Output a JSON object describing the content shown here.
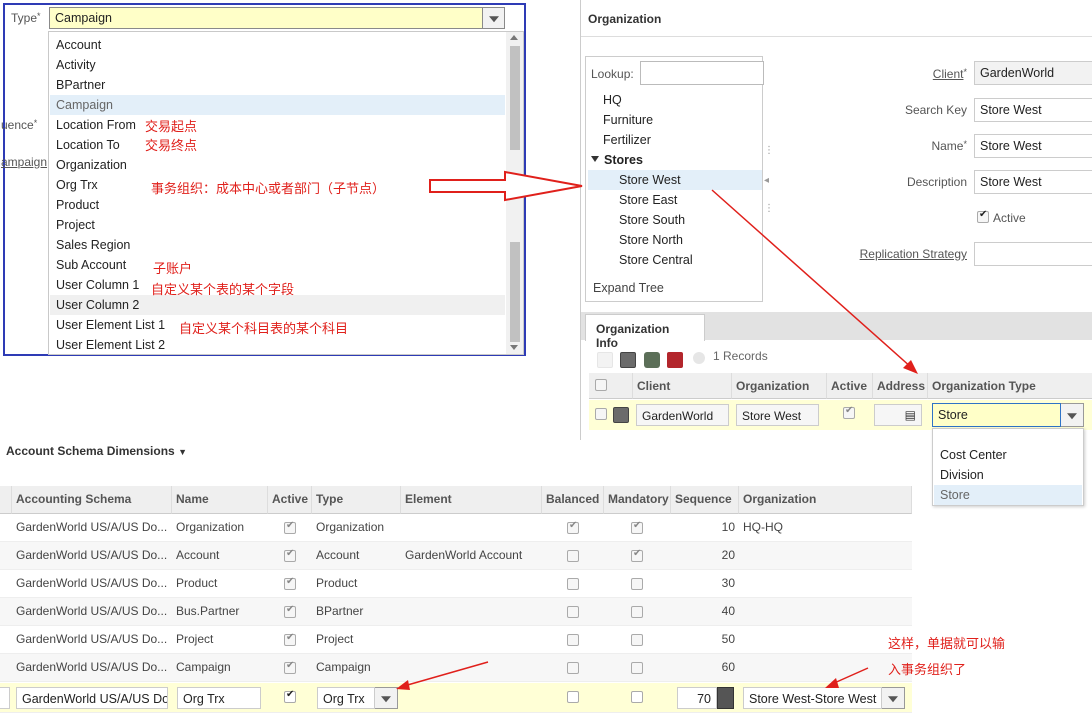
{
  "type_field": {
    "label": "Type",
    "required_mark": "*",
    "value": "Campaign",
    "options": [
      "Account",
      "Activity",
      "BPartner",
      "Campaign",
      "Location From",
      "Location To",
      "Organization",
      "Org Trx",
      "Product",
      "Project",
      "Sales Region",
      "Sub Account",
      "User Column 1",
      "User Column 2",
      "User Element List 1",
      "User Element List 2"
    ],
    "selected_option": "Campaign",
    "side_labels": {
      "sequence": "uence",
      "campaign": "ampaign"
    }
  },
  "annotations": {
    "location_from": "交易起点",
    "location_to": "交易终点",
    "org_trx": "事务组织：成本中心或者部门（子节点）",
    "sub_account": "子账户",
    "user_column": "自定义某个表的某个字段",
    "user_element_list": "自定义某个科目表的某个科目",
    "conclusion_line1": "这样，单据就可以输",
    "conclusion_line2": "入事务组织了"
  },
  "org_panel": {
    "title": "Organization",
    "lookup_label": "Lookup:",
    "lookup_value": "",
    "tree": [
      "HQ",
      "Furniture",
      "Fertilizer",
      "Stores",
      "Store West",
      "Store East",
      "Store South",
      "Store North",
      "Store Central"
    ],
    "tree_selected": "Store West",
    "expand_tree": "Expand Tree",
    "form": {
      "client_label": "Client",
      "client_value": "GardenWorld",
      "search_key_label": "Search Key",
      "search_key_value": "Store West",
      "name_label": "Name",
      "name_value": "Store West",
      "description_label": "Description",
      "description_value": "Store West",
      "active_label": "Active",
      "replication_label": "Replication Strategy",
      "replication_value": ""
    },
    "info_tab": "Organization Info",
    "records": "1 Records",
    "grid_headers": [
      "Client",
      "Organization",
      "Active",
      "Address",
      "Organization Type"
    ],
    "grid_row": {
      "client": "GardenWorld",
      "organization": "Store West",
      "org_type": "Store"
    },
    "org_type_options": [
      "Cost Center",
      "Division",
      "Store"
    ],
    "org_type_selected": "Store"
  },
  "dimensions": {
    "title": "Account Schema Dimensions",
    "headers": [
      "Accounting Schema",
      "Name",
      "Active",
      "Type",
      "Element",
      "Balanced",
      "Mandatory",
      "Sequence",
      "Organization"
    ],
    "rows": [
      {
        "schema": "GardenWorld US/A/US Do...",
        "name": "Organization",
        "type": "Organization",
        "element": "",
        "balanced": true,
        "mandatory": true,
        "sequence": "10",
        "organization": "HQ-HQ"
      },
      {
        "schema": "GardenWorld US/A/US Do...",
        "name": "Account",
        "type": "Account",
        "element": "GardenWorld Account",
        "balanced": false,
        "mandatory": true,
        "sequence": "20",
        "organization": ""
      },
      {
        "schema": "GardenWorld US/A/US Do...",
        "name": "Product",
        "type": "Product",
        "element": "",
        "balanced": false,
        "mandatory": false,
        "sequence": "30",
        "organization": ""
      },
      {
        "schema": "GardenWorld US/A/US Do...",
        "name": "Bus.Partner",
        "type": "BPartner",
        "element": "",
        "balanced": false,
        "mandatory": false,
        "sequence": "40",
        "organization": ""
      },
      {
        "schema": "GardenWorld US/A/US Do...",
        "name": "Project",
        "type": "Project",
        "element": "",
        "balanced": false,
        "mandatory": false,
        "sequence": "50",
        "organization": ""
      },
      {
        "schema": "GardenWorld US/A/US Do...",
        "name": "Campaign",
        "type": "Campaign",
        "element": "",
        "balanced": false,
        "mandatory": false,
        "sequence": "60",
        "organization": ""
      }
    ],
    "edit_row": {
      "schema": "GardenWorld US/A/US Do",
      "name": "Org Trx",
      "type": "Org Trx",
      "sequence": "70",
      "organization": "Store West-Store West"
    }
  },
  "colors": {
    "panel_border": "#2e3bb5",
    "annotation": "#e0201b",
    "selection": "#e3eff9",
    "edit_row": "#ffffd6",
    "required_input": "#ffffc8"
  }
}
